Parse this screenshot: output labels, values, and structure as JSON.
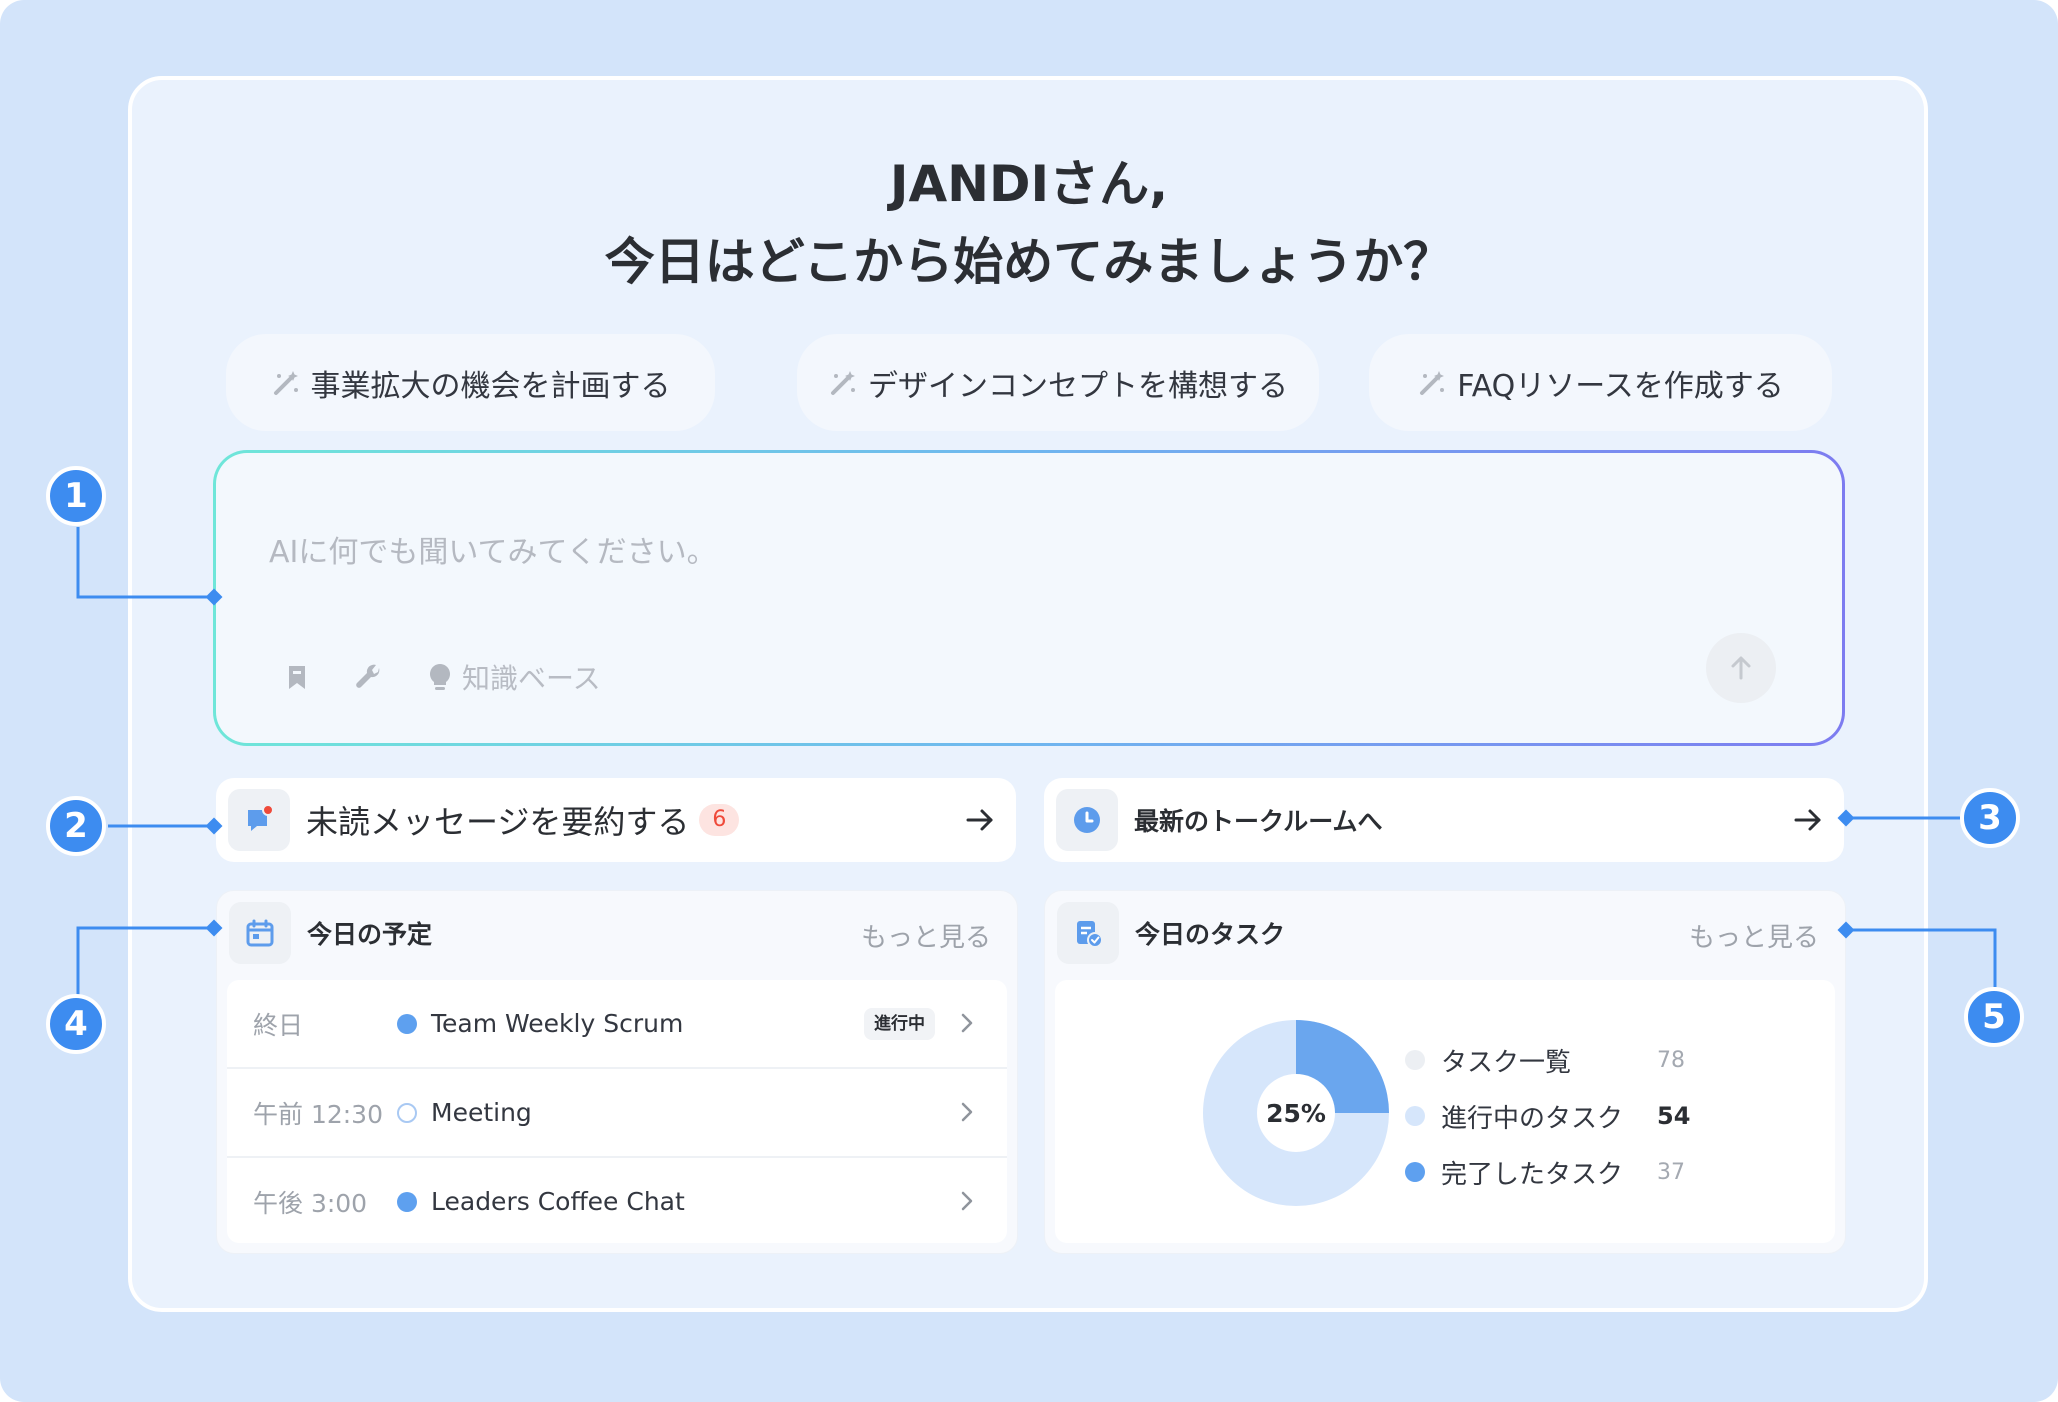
{
  "greeting": {
    "line1": "JANDIさん,",
    "line2": "今日はどこから始めてみましょうか？"
  },
  "suggestions": [
    {
      "label": "事業拡大の機会を計画する",
      "icon": "magic-wand-icon"
    },
    {
      "label": "デザインコンセプトを構想する",
      "icon": "magic-wand-icon"
    },
    {
      "label": "FAQリソースを作成する",
      "icon": "magic-wand-icon"
    }
  ],
  "ai_input": {
    "placeholder": "AIに何でも聞いてみてください。",
    "knowledge_base_label": "知識ベース",
    "tools": [
      "bookmark-icon",
      "wrench-icon",
      "lightbulb-icon"
    ],
    "send_icon": "arrow-up-icon"
  },
  "actions": {
    "unread": {
      "label": "未読メッセージを要約する",
      "count": "6",
      "icon": "chat-notification-icon"
    },
    "latest_room": {
      "label": "最新のトークルームへ",
      "icon": "clock-icon"
    }
  },
  "schedule": {
    "title": "今日の予定",
    "more_label": "もっと見る",
    "icon": "calendar-icon",
    "items": [
      {
        "time": "終日",
        "name": "Team Weekly Scrum",
        "status": "進行中",
        "dot": "filled"
      },
      {
        "time": "午前 12:30",
        "name": "Meeting",
        "status": "",
        "dot": "outline"
      },
      {
        "time": "午後 3:00",
        "name": "Leaders Coffee Chat",
        "status": "",
        "dot": "filled"
      }
    ]
  },
  "tasks": {
    "title": "今日のタスク",
    "more_label": "もっと見る",
    "icon": "task-check-icon",
    "completion_label": "25%",
    "completion_fraction": 0.25,
    "legend": [
      {
        "label": "タスク一覧",
        "value": "78",
        "color": "#eceff3"
      },
      {
        "label": "進行中のタスク",
        "value": "54",
        "color": "#d6e6fb"
      },
      {
        "label": "完了したタスク",
        "value": "37",
        "color": "#5ea0ef"
      }
    ]
  },
  "callouts": [
    "1",
    "2",
    "3",
    "4",
    "5"
  ],
  "colors": {
    "background": "#d3e4fa",
    "accent": "#3d8cf0",
    "badge_text": "#ef4a3a",
    "donut_done": "#6aa6ee",
    "donut_rest": "#d6e6fb"
  }
}
